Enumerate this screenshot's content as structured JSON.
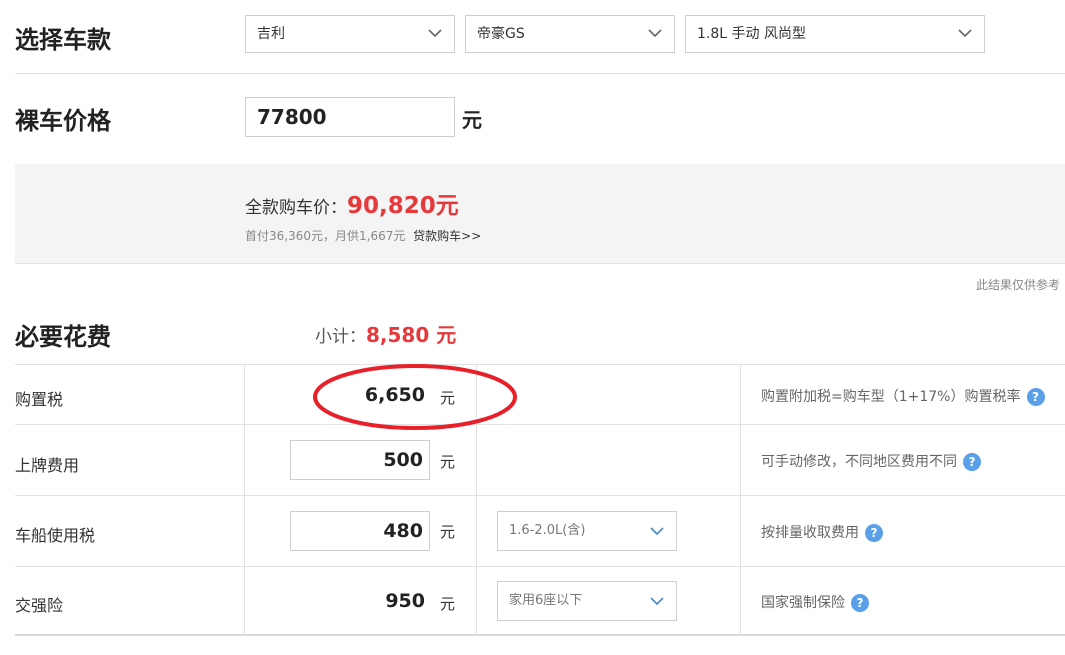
{
  "select_car": {
    "title": "选择车款",
    "brand": "吉利",
    "model": "帝豪GS",
    "trim": "1.8L 手动 风尚型"
  },
  "bare_price": {
    "title": "裸车价格",
    "value": "77800",
    "unit": "元"
  },
  "summary": {
    "full_price_label": "全款购车价：",
    "full_price_value": "90,820元",
    "loan_info": "首付36,360元，月供1,667元",
    "loan_link": "贷款购车>>"
  },
  "disclaimer": "此结果仅供参考",
  "necessary": {
    "title": "必要花费",
    "subtotal_label": "小计：",
    "subtotal_value": "8,580 元",
    "rows": [
      {
        "label": "购置税",
        "amount": "6,650",
        "unit": "元",
        "option": "",
        "note": "购置附加税=购车型（1+17%）购置税率",
        "help": "?"
      },
      {
        "label": "上牌费用",
        "amount": "500",
        "unit": "元",
        "option": "",
        "note": "可手动修改，不同地区费用不同",
        "help": "?"
      },
      {
        "label": "车船使用税",
        "amount": "480",
        "unit": "元",
        "option": "1.6-2.0L(含)",
        "note": "按排量收取费用",
        "help": "?"
      },
      {
        "label": "交强险",
        "amount": "950",
        "unit": "元",
        "option": "家用6座以下",
        "note": "国家强制保险",
        "help": "?"
      }
    ]
  },
  "colors": {
    "accent_red": "#e5393b",
    "help_blue": "#5aa0e8"
  }
}
